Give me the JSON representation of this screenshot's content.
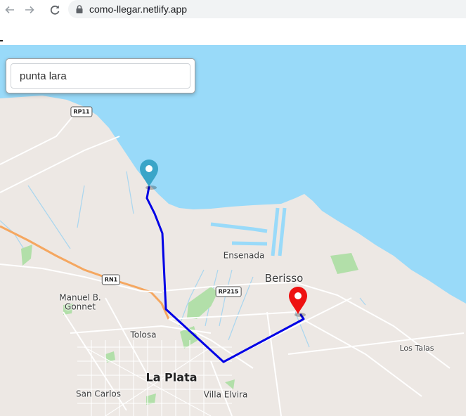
{
  "browser": {
    "url": "como-llegar.netlify.app"
  },
  "search": {
    "value": "punta lara"
  },
  "map": {
    "place_labels": {
      "ensenada": "Ensenada",
      "berisso": "Berisso",
      "manuel_b_gonnet": "Manuel B.\nGonnet",
      "tolosa": "Tolosa",
      "la_plata": "La Plata",
      "san_carlos": "San Carlos",
      "villa_elvira": "Villa Elvira",
      "los_talas": "Los Talas"
    },
    "road_shields": {
      "rp11": "RP11",
      "rn1": "RN1",
      "rp215": "RP215"
    },
    "colors": {
      "water": "#99daf9",
      "land": "#ede8e4",
      "park": "#b2dfa9",
      "route": "#0000e6",
      "origin_marker": "#3aa5c8",
      "destination_marker": "#ee1111",
      "highway": "#f5a760"
    },
    "markers": {
      "origin": "origin-pin",
      "destination": "destination-pin"
    }
  }
}
